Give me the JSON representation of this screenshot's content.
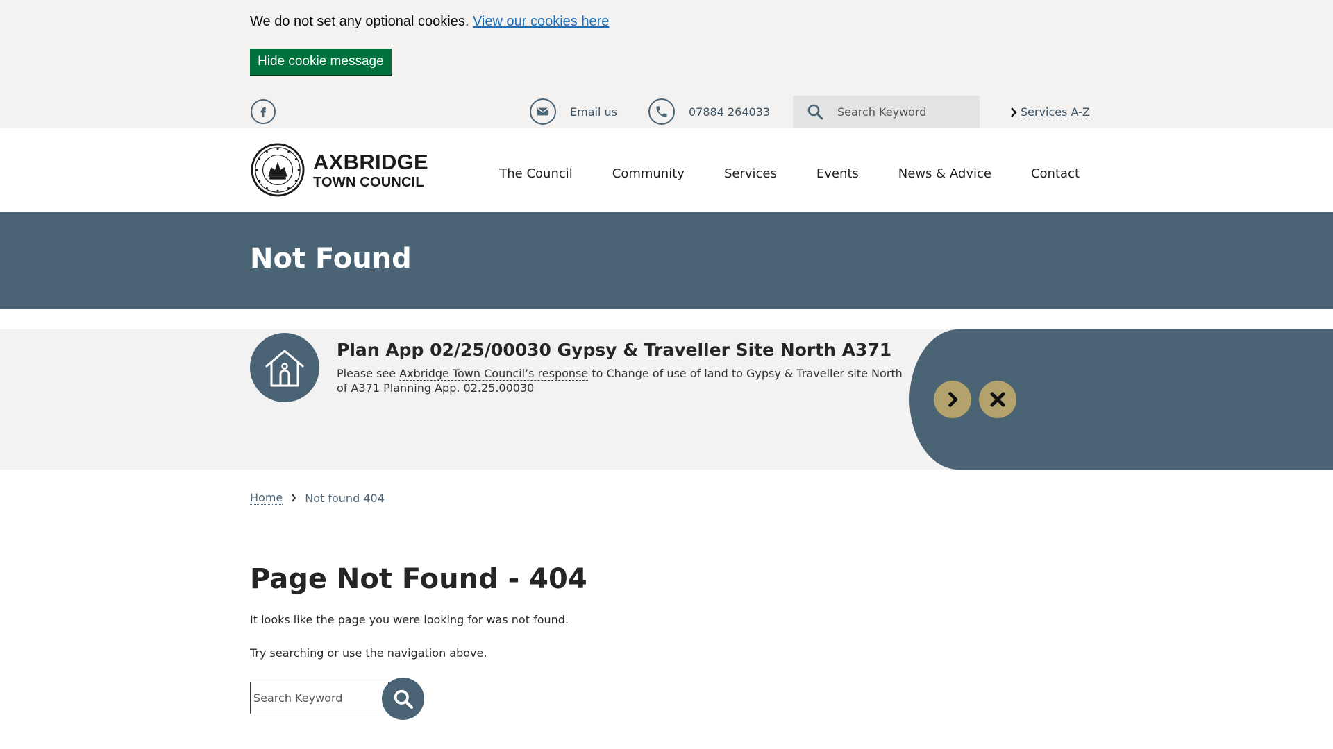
{
  "cookie": {
    "text": "We do not set any optional cookies.",
    "link_label": "View our cookies here",
    "hide_label": "Hide cookie message"
  },
  "utility": {
    "social_icon": "facebook-icon",
    "email_label": "Email us",
    "phone_label": "07884 264033",
    "search_placeholder": "Search Keyword",
    "az_label": "Services A-Z"
  },
  "logo": {
    "line1": "AXBRIDGE",
    "line2": "TOWN COUNCIL"
  },
  "nav": {
    "items": [
      {
        "label": "The Council"
      },
      {
        "label": "Community"
      },
      {
        "label": "Services"
      },
      {
        "label": "Events"
      },
      {
        "label": "News & Advice"
      },
      {
        "label": "Contact"
      }
    ]
  },
  "title_band": {
    "heading": "Not Found"
  },
  "alert": {
    "icon": "house-icon",
    "title": "Plan App 02/25/00030 Gypsy & Traveller Site North A371",
    "body_prefix": "Please see ",
    "body_link": "Axbridge Town Council’s response",
    "body_suffix": " to Change of use of land to Gypsy & Traveller site North of A371 Planning App. 02.25.00030"
  },
  "breadcrumb": {
    "home": "Home",
    "current": "Not found 404"
  },
  "main": {
    "heading": "Page Not Found - 404",
    "paragraph1": "It looks like the page you were looking for was not found.",
    "paragraph2": "Try searching or use the navigation above.",
    "search_placeholder": "Search Keyword"
  },
  "colors": {
    "slate": "#4a6375",
    "gold": "#b3a26b",
    "cookie_green": "#00703c",
    "link_blue": "#1d70b8"
  }
}
